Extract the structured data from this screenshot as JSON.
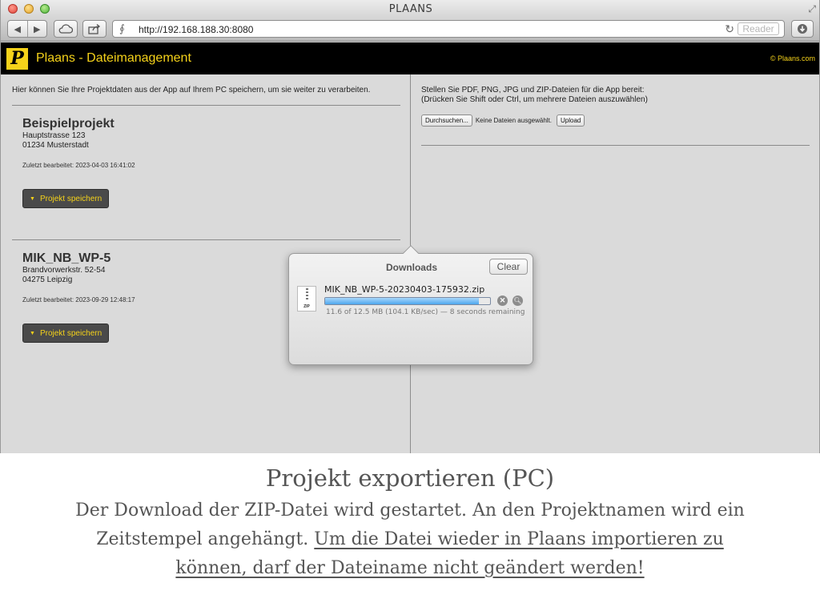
{
  "window": {
    "title": "PLAANS"
  },
  "toolbar": {
    "url": "http://192.168.188.30:8080",
    "reader_label": "Reader"
  },
  "app": {
    "logo_letter": "P",
    "title": "Plaans - Dateimanagement",
    "copyright": "© Plaans.com"
  },
  "left": {
    "intro": "Hier können Sie Ihre Projektdaten aus der App auf Ihrem PC speichern, um sie weiter zu verarbeiten.",
    "projects": [
      {
        "name": "Beispielprojekt",
        "street": "Hauptstrasse 123",
        "city": "01234 Musterstadt",
        "edited": "Zuletzt bearbeitet: 2023-04-03 16:41:02",
        "save_label": "Projekt speichern"
      },
      {
        "name": "MIK_NB_WP-5",
        "street": "Brandvorwerkstr. 52-54",
        "city": "04275 Leipzig",
        "edited": "Zuletzt bearbeitet: 2023-09-29 12:48:17",
        "save_label": "Projekt speichern"
      }
    ]
  },
  "right": {
    "upload_line1": "Stellen Sie PDF, PNG, JPG und ZIP-Dateien für die App bereit:",
    "upload_line2": "(Drücken Sie Shift oder Ctrl, um mehrere Dateien auszuwählen)",
    "browse_label": "Durchsuchen...",
    "no_files": "Keine Dateien ausgewählt.",
    "upload_label": "Upload"
  },
  "downloads": {
    "title": "Downloads",
    "clear_label": "Clear",
    "file_icon_label": "ZIP",
    "filename": "MIK_NB_WP-5-20230403-175932.zip",
    "progress": 0.93,
    "status": "11.6 of 12.5 MB (104.1 KB/sec) — 8 seconds remaining"
  },
  "caption": {
    "title": "Projekt exportieren (PC)",
    "body_plain": "Der Download der ZIP-Datei wird gestartet. An den Projektnamen wird ein Zeitstempel angehängt. ",
    "body_underlined": "Um die Datei wieder in Plaans importieren zu können, darf der Dateiname nicht geändert werden!"
  },
  "colors": {
    "accent_yellow": "#f5d21a",
    "header_black": "#000000",
    "progress_blue": "#4ea7ee"
  }
}
